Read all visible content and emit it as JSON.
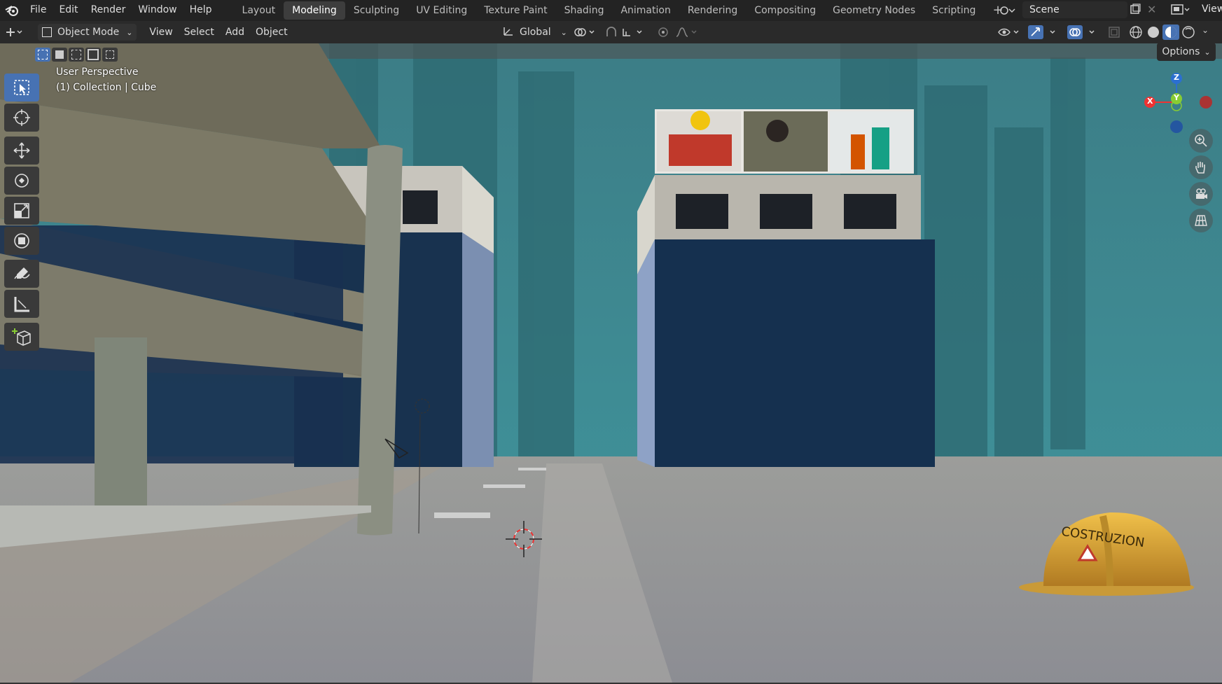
{
  "menus": [
    "File",
    "Edit",
    "Render",
    "Window",
    "Help"
  ],
  "workspaces": [
    "Layout",
    "Modeling",
    "Sculpting",
    "UV Editing",
    "Texture Paint",
    "Shading",
    "Animation",
    "Rendering",
    "Compositing",
    "Geometry Nodes",
    "Scripting"
  ],
  "active_workspace": "Modeling",
  "scene_name": "Scene",
  "view_label": "View",
  "header": {
    "mode": "Object Mode",
    "menus": [
      "View",
      "Select",
      "Add",
      "Object"
    ],
    "transform_orientation": "Global"
  },
  "viewport": {
    "perspective": "User Perspective",
    "collection": "(1) Collection | Cube",
    "options_label": "Options",
    "gizmo": {
      "z": "Z",
      "y": "Y",
      "x": "X"
    },
    "helmet_text": "COSTRUZION"
  },
  "tools": [
    "select-box",
    "cursor",
    "move",
    "rotate",
    "scale",
    "transform",
    "annotate",
    "measure",
    "add-cube"
  ],
  "colors": {
    "active_tab": "#3d3d3d",
    "accent": "#4772b3",
    "sky": "#3f8c92",
    "building": "#16304f",
    "helmet": "#e0a83a"
  }
}
